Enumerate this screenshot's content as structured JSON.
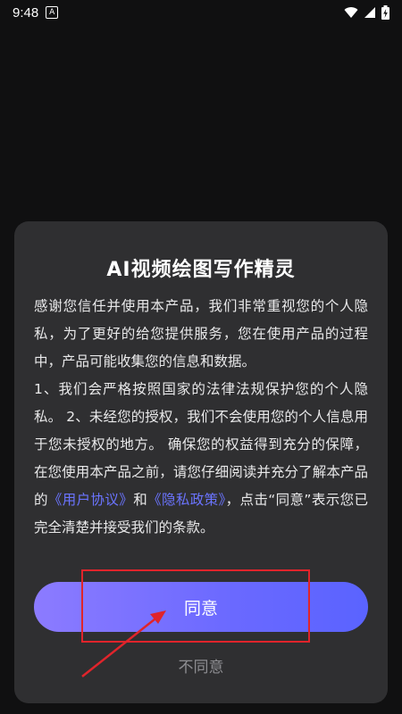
{
  "status_bar": {
    "time": "9:48",
    "notification_glyph": "A",
    "icons": [
      "wifi-icon",
      "signal-icon",
      "battery-charging-icon"
    ],
    "color": "#ffffff"
  },
  "dialog": {
    "title": "AI视频绘图写作精灵",
    "body": {
      "p1": "感谢您信任并使用本产品，我们非常重视您的个人隐私，为了更好的给您提供服务，您在使用产品的过程中，产品可能收集您的信息和数据。",
      "p2": "1、我们会严格按照国家的法律法规保护您的个人隐私。 2、未经您的授权，我们不会使用您的个人信息用于您未授权的地方。 确保您的权益得到充分的保障，在您使用本产品之前，请您仔细阅读并充分了解本产品的",
      "user_agreement_link": "《用户协议》",
      "and_text": "和",
      "privacy_policy_link": "《隐私政策》",
      "tail": "，点击“同意”表示您已完全清楚并接受我们的条款。"
    },
    "agree_label": "同意",
    "disagree_label": "不同意",
    "colors": {
      "dialog_bg": "#2f2f31",
      "link": "#6b74ff",
      "button_gradient_start": "#8c7bff",
      "button_gradient_end": "#5a63ff",
      "annotation": "#e0242b"
    }
  }
}
